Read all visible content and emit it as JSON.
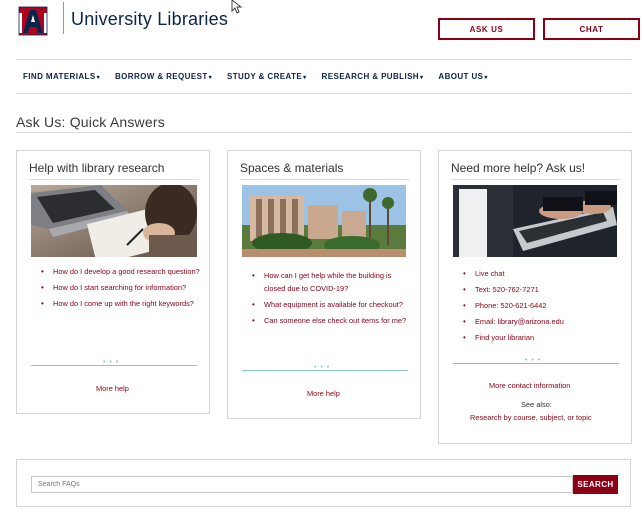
{
  "header": {
    "site_title": "University Libraries",
    "ask_us_label": "ASK US",
    "chat_label": "CHAT",
    "brand_color": "#8b0015",
    "navy_color": "#0c234b"
  },
  "nav": {
    "items": [
      {
        "label": "FIND MATERIALS"
      },
      {
        "label": "BORROW & REQUEST"
      },
      {
        "label": "STUDY & CREATE"
      },
      {
        "label": "RESEARCH & PUBLISH"
      },
      {
        "label": "ABOUT US"
      }
    ],
    "caret": "▾"
  },
  "page": {
    "title": "Ask Us: Quick Answers"
  },
  "cards": [
    {
      "title": "Help with library research",
      "items": [
        "How do I develop a good research question?",
        "How do I start searching for information?",
        "How do I come up with the right keywords?"
      ],
      "link": "More help"
    },
    {
      "title": "Spaces & materials",
      "items": [
        "How can I get help while the building is closed due to COVID-19?",
        "What equipment is available for checkout?",
        "Can someone else check out items for me?"
      ],
      "link": "More help"
    },
    {
      "title": "Need more help? Ask us!",
      "items": [
        "Live chat",
        "Text: 520-762-7271",
        "Phone: 520-621-6442",
        "Email: library@arizona.edu",
        "Find your librarian"
      ],
      "link": "More contact information",
      "see_also": "See also:",
      "see_also_link": "Research by course, subject, or topic"
    }
  ],
  "search": {
    "placeholder": "Search FAQs",
    "button_label": "SEARCH"
  }
}
